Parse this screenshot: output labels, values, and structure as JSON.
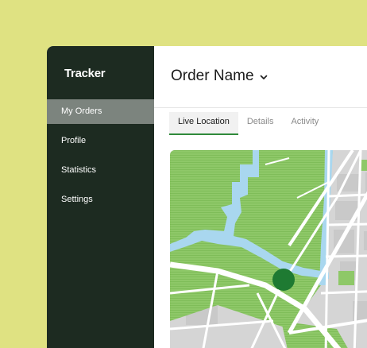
{
  "app": {
    "brand": "Tracker"
  },
  "sidebar": {
    "items": [
      {
        "label": "My Orders",
        "active": true
      },
      {
        "label": "Profile",
        "active": false
      },
      {
        "label": "Statistics",
        "active": false
      },
      {
        "label": "Settings",
        "active": false
      }
    ]
  },
  "header": {
    "title": "Order Name",
    "dropdown_icon": "chevron-down-icon"
  },
  "tabs": [
    {
      "label": "Live Location",
      "active": true
    },
    {
      "label": "Details",
      "active": false
    },
    {
      "label": "Activity",
      "active": false
    }
  ],
  "map": {
    "marker_icon": "location-marker-icon",
    "colors": {
      "park": "#8ec868",
      "water": "#a9d7ef",
      "road": "#ffffff",
      "block": "#d5d5d5",
      "marker": "#1e7a32",
      "accent": "#2f8a3a"
    }
  }
}
